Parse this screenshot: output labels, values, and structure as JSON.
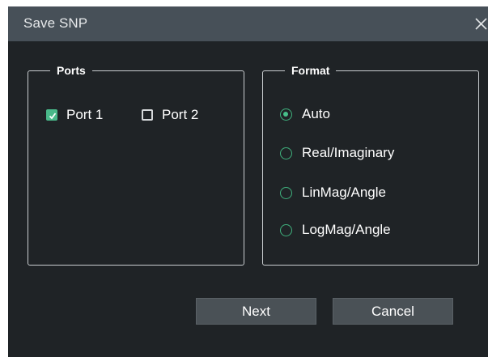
{
  "dialog": {
    "title": "Save SNP",
    "close_icon": "close-icon"
  },
  "ports": {
    "legend": "Ports",
    "items": [
      {
        "label": "Port 1",
        "checked": true
      },
      {
        "label": "Port 2",
        "checked": false
      }
    ]
  },
  "format": {
    "legend": "Format",
    "options": [
      {
        "label": "Auto",
        "selected": true
      },
      {
        "label": "Real/Imaginary",
        "selected": false
      },
      {
        "label": "LinMag/Angle",
        "selected": false
      },
      {
        "label": "LogMag/Angle",
        "selected": false
      }
    ]
  },
  "buttons": {
    "next": "Next",
    "cancel": "Cancel"
  },
  "colors": {
    "titlebar": "#475058",
    "background": "#1f2326",
    "accent": "#49b889",
    "button": "#4a5156"
  }
}
